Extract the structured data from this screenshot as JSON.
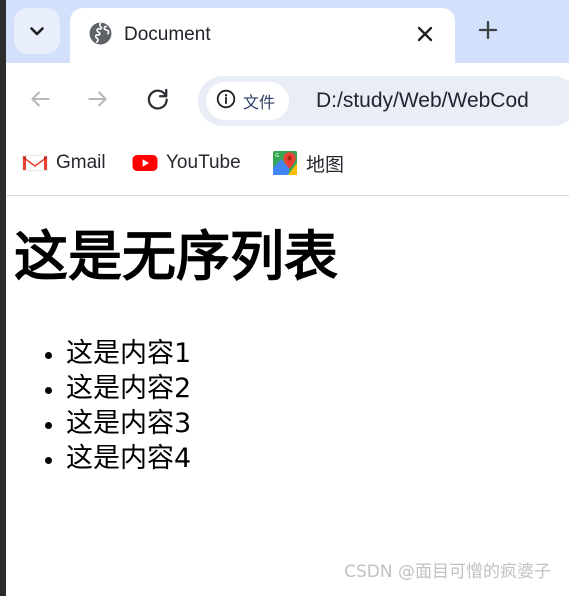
{
  "window": {
    "tab_strip": {
      "tab_list_button_icon": "chevron-down-icon",
      "new_tab_button_icon": "plus-icon",
      "tabs": [
        {
          "title": "Document",
          "favicon": "globe-icon",
          "close_icon": "close-x-icon",
          "active": true
        }
      ]
    },
    "toolbar": {
      "back_icon": "arrow-left-icon",
      "forward_icon": "arrow-right-icon",
      "reload_icon": "reload-icon",
      "omnibox": {
        "site_info_icon": "info-circle-icon",
        "site_info_label": "文件",
        "url": "D:/study/Web/WebCod"
      }
    },
    "bookmarks_bar": {
      "items": [
        {
          "label": "Gmail",
          "icon": "gmail-icon"
        },
        {
          "label": "YouTube",
          "icon": "youtube-icon"
        },
        {
          "label": "地图",
          "icon": "google-maps-icon"
        }
      ]
    }
  },
  "page": {
    "heading": "这是无序列表",
    "list_items": [
      "这是内容1",
      "这是内容2",
      "这是内容3",
      "这是内容4"
    ]
  },
  "watermark": {
    "text": "CSDN @面目可憎的疯婆子"
  },
  "colors": {
    "tab_strip_bg": "#d3e0fb",
    "tab_active_bg": "#ffffff",
    "tab_list_button_bg": "#e8eefc",
    "omnibox_bg": "#e9edf6",
    "window_edge": "#2c2c2c",
    "gmail_red": "#ea4335",
    "youtube_red": "#ff0000",
    "maps_green": "#34a853",
    "maps_blue": "#4285f4",
    "maps_yellow": "#fbbc04",
    "maps_pin_red": "#ea4335",
    "watermark_gray": "#c2c2c2"
  }
}
